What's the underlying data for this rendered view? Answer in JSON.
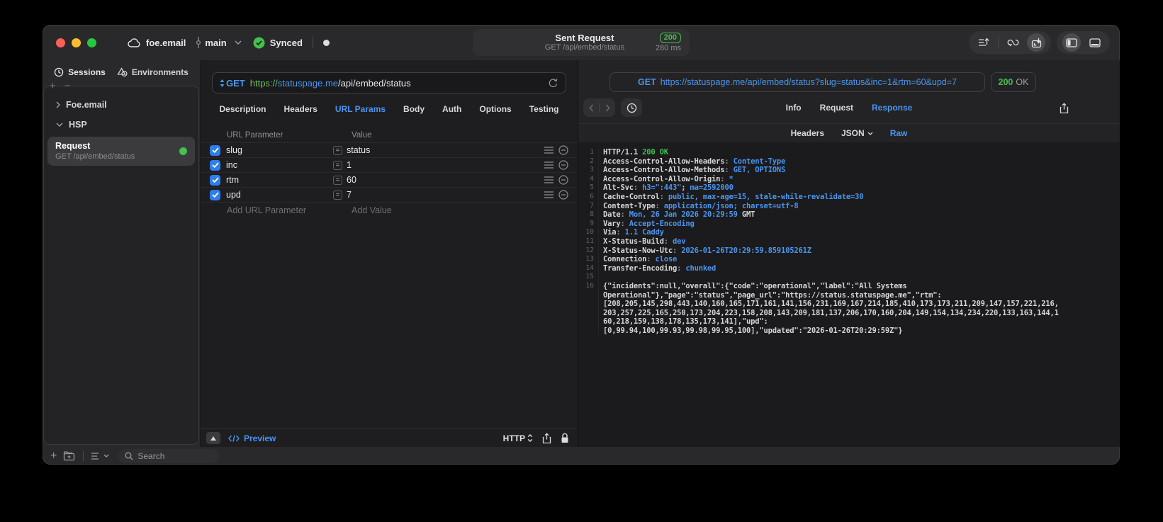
{
  "titlebar": {
    "cloud_label": "foe.email",
    "branch": "main",
    "sync_status": "Synced",
    "request_title": "Sent Request",
    "request_subtitle": "GET /api/embed/status",
    "status_badge": "200",
    "time_badge": "280 ms",
    "accent_green": "#43c04d"
  },
  "sidebar": {
    "tabs": [
      {
        "label": "Sessions",
        "icon": "history-clock-icon"
      },
      {
        "label": "Environments",
        "icon": "shapes-icon"
      }
    ],
    "tree": [
      {
        "label": "Foe.email",
        "expanded": false
      },
      {
        "label": "HSP",
        "expanded": true
      }
    ],
    "request_item": {
      "title": "Request",
      "subtitle": "GET /api/embed/status",
      "status_dot": "green"
    },
    "search_placeholder": "Search"
  },
  "request_pane": {
    "method": "GET",
    "url_scheme": "https://",
    "url_host": "statuspage.me",
    "url_path": "/api/embed/status",
    "tabs": [
      "Description",
      "Headers",
      "URL Params",
      "Body",
      "Auth",
      "Options",
      "Testing"
    ],
    "active_tab": "URL Params",
    "table": {
      "columns": [
        "URL Parameter",
        "Value"
      ],
      "rows": [
        {
          "name": "slug",
          "value": "status",
          "checked": true
        },
        {
          "name": "inc",
          "value": "1",
          "checked": true
        },
        {
          "name": "rtm",
          "value": "60",
          "checked": true
        },
        {
          "name": "upd",
          "value": "7",
          "checked": true
        }
      ],
      "add_name_placeholder": "Add URL Parameter",
      "add_value_placeholder": "Add Value"
    },
    "footer": {
      "preview_label": "Preview",
      "protocol": "HTTP"
    }
  },
  "response_pane": {
    "method": "GET",
    "url": "https://statuspage.me/api/embed/status?slug=status&inc=1&rtm=60&upd=7",
    "status_code": "200",
    "status_text": "OK",
    "tabs": [
      "Info",
      "Request",
      "Response"
    ],
    "active_tab": "Response",
    "subtabs": [
      "Headers",
      "JSON",
      "Raw"
    ],
    "active_subtab": "Raw",
    "dropdown_subtab": "JSON",
    "accent_blue": "#4896f0",
    "lines": [
      {
        "n": "1",
        "segments": [
          {
            "t": "HTTP/1.1 ",
            "c": "w"
          },
          {
            "t": "200 OK",
            "c": "g"
          }
        ]
      },
      {
        "n": "2",
        "segments": [
          {
            "t": "Access-Control-Allow-Headers",
            "c": "w"
          },
          {
            "t": ": ",
            "c": "d"
          },
          {
            "t": "Content-Type",
            "c": "b"
          }
        ]
      },
      {
        "n": "3",
        "segments": [
          {
            "t": "Access-Control-Allow-Methods",
            "c": "w"
          },
          {
            "t": ": ",
            "c": "d"
          },
          {
            "t": "GET, OPTIONS",
            "c": "b"
          }
        ]
      },
      {
        "n": "4",
        "segments": [
          {
            "t": "Access-Control-Allow-Origin",
            "c": "w"
          },
          {
            "t": ": ",
            "c": "d"
          },
          {
            "t": "*",
            "c": "b"
          }
        ]
      },
      {
        "n": "5",
        "segments": [
          {
            "t": "Alt-Svc",
            "c": "w"
          },
          {
            "t": ": ",
            "c": "d"
          },
          {
            "t": "h3=\":443\"",
            "c": "b"
          },
          {
            "t": "; ",
            "c": "w"
          },
          {
            "t": "ma=2592000",
            "c": "b"
          }
        ]
      },
      {
        "n": "6",
        "segments": [
          {
            "t": "Cache-Control",
            "c": "w"
          },
          {
            "t": ": ",
            "c": "d"
          },
          {
            "t": "public, max-age=15, stale-while-revalidate=30",
            "c": "b"
          }
        ]
      },
      {
        "n": "7",
        "segments": [
          {
            "t": "Content-Type",
            "c": "w"
          },
          {
            "t": ": ",
            "c": "d"
          },
          {
            "t": "application/json; charset=utf-8",
            "c": "b"
          }
        ]
      },
      {
        "n": "8",
        "segments": [
          {
            "t": "Date",
            "c": "w"
          },
          {
            "t": ": ",
            "c": "d"
          },
          {
            "t": "Mon, 26 Jan 2026 20:29:59",
            "c": "b"
          },
          {
            "t": " GMT",
            "c": "w"
          }
        ]
      },
      {
        "n": "9",
        "segments": [
          {
            "t": "Vary",
            "c": "w"
          },
          {
            "t": ": ",
            "c": "d"
          },
          {
            "t": "Accept-Encoding",
            "c": "b"
          }
        ]
      },
      {
        "n": "10",
        "segments": [
          {
            "t": "Via",
            "c": "w"
          },
          {
            "t": ": ",
            "c": "d"
          },
          {
            "t": "1.1 Caddy",
            "c": "b"
          }
        ]
      },
      {
        "n": "11",
        "segments": [
          {
            "t": "X-Status-Build",
            "c": "w"
          },
          {
            "t": ": ",
            "c": "d"
          },
          {
            "t": "dev",
            "c": "b"
          }
        ]
      },
      {
        "n": "12",
        "segments": [
          {
            "t": "X-Status-Now-Utc",
            "c": "w"
          },
          {
            "t": ": ",
            "c": "d"
          },
          {
            "t": "2026-01-26T20:29:59.859105261Z",
            "c": "b"
          }
        ]
      },
      {
        "n": "13",
        "segments": [
          {
            "t": "Connection",
            "c": "w"
          },
          {
            "t": ": ",
            "c": "d"
          },
          {
            "t": "close",
            "c": "b"
          }
        ]
      },
      {
        "n": "14",
        "segments": [
          {
            "t": "Transfer-Encoding",
            "c": "w"
          },
          {
            "t": ": ",
            "c": "d"
          },
          {
            "t": "chunked",
            "c": "b"
          }
        ]
      },
      {
        "n": "15",
        "segments": []
      },
      {
        "n": "16",
        "segments": [
          {
            "t": "{\"incidents\":null,\"overall\":{\"code\":\"operational\",\"label\":\"All Systems",
            "c": "w"
          }
        ]
      },
      {
        "n": "",
        "segments": [
          {
            "t": "Operational\"},\"page\":\"status\",\"page_url\":\"https://status.statuspage.me\",\"rtm\":",
            "c": "w"
          }
        ]
      },
      {
        "n": "",
        "segments": [
          {
            "t": "[208,205,145,298,443,140,160,165,171,161,141,156,231,169,167,214,185,410,173,173,211,209,147,157,221,216,",
            "c": "w"
          }
        ]
      },
      {
        "n": "",
        "segments": [
          {
            "t": "203,257,225,165,250,173,204,223,158,208,143,209,181,137,206,170,160,204,149,154,134,234,220,133,163,144,1",
            "c": "w"
          }
        ]
      },
      {
        "n": "",
        "segments": [
          {
            "t": "60,218,159,138,178,135,173,141],\"upd\":",
            "c": "w"
          }
        ]
      },
      {
        "n": "",
        "segments": [
          {
            "t": "[0,99.94,100,99.93,99.98,99.95,100],\"updated\":\"2026-01-26T20:29:59Z\"}",
            "c": "w"
          }
        ]
      }
    ]
  }
}
